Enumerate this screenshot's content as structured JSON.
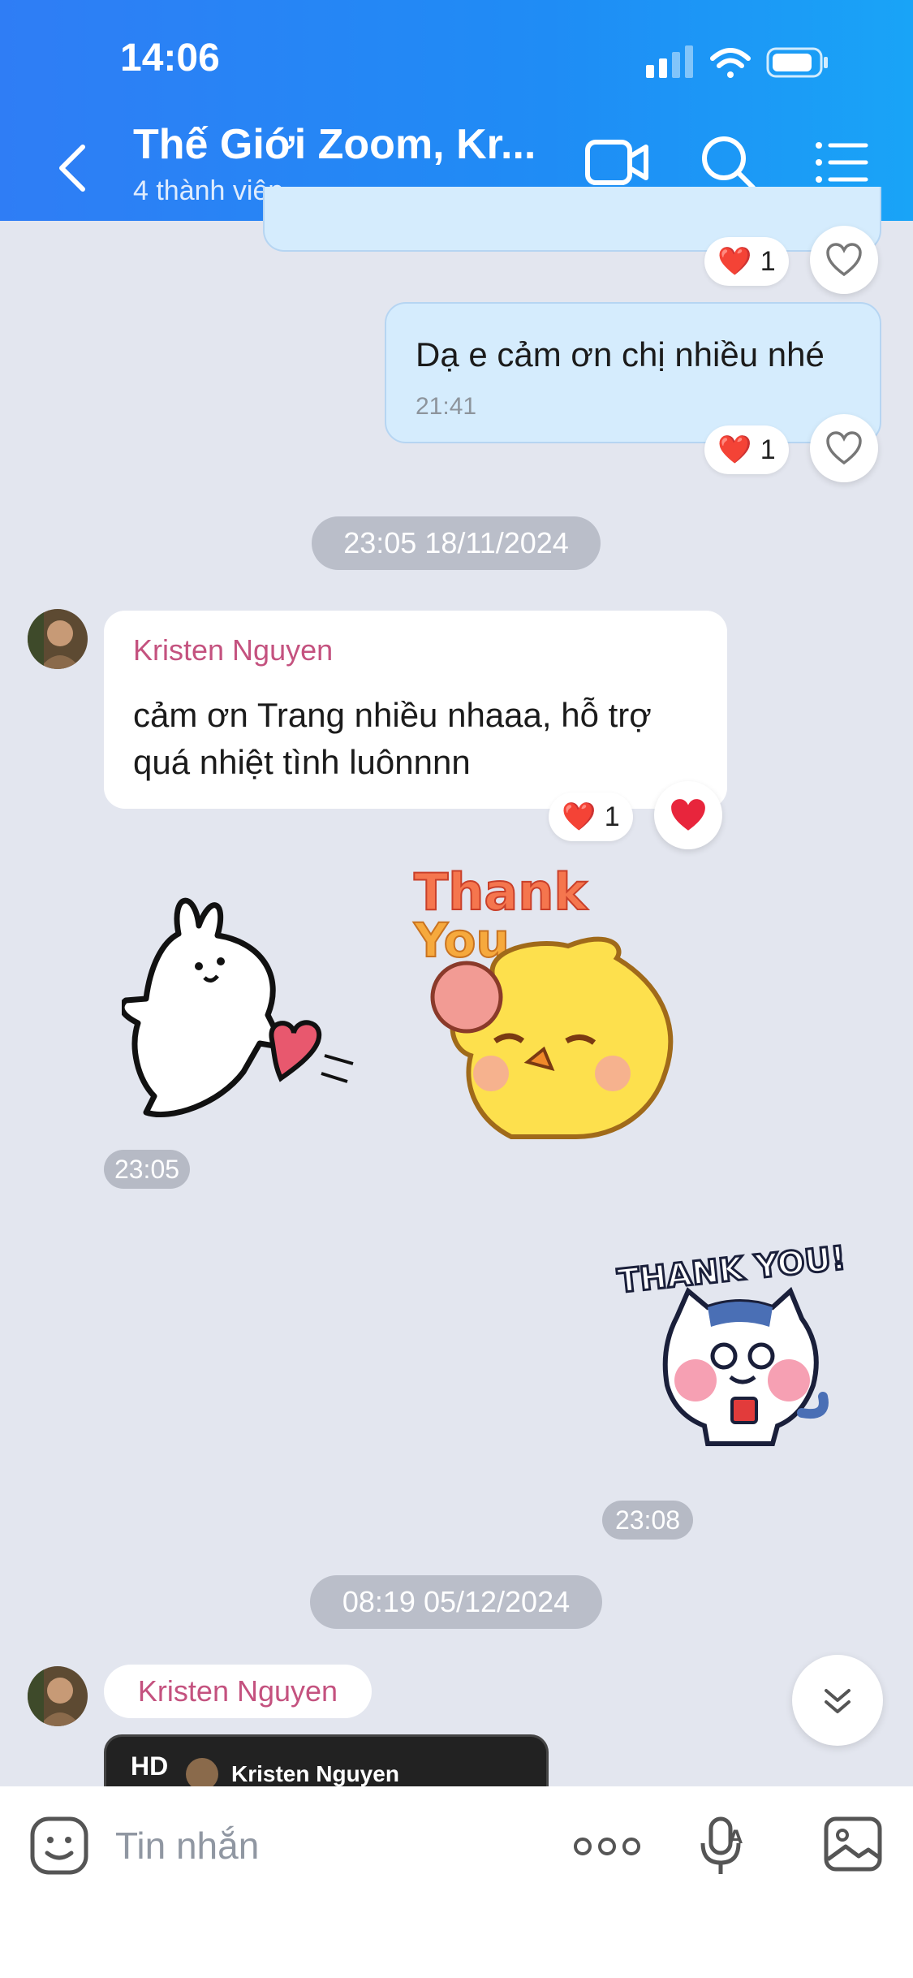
{
  "status_bar": {
    "time": "14:06"
  },
  "header": {
    "title": "Thế Giới Zoom, Kr...",
    "subtitle": "4 thành viên",
    "icons": [
      "back-icon",
      "video-call-icon",
      "search-icon",
      "menu-icon"
    ]
  },
  "messages": {
    "reaction_top": {
      "count": "1"
    },
    "mine_1": {
      "text": "Dạ e cảm ơn chị nhiều nhé",
      "time": "21:41",
      "reaction_count": "1"
    },
    "date_1": "23:05 18/11/2024",
    "kristen_1": {
      "sender": "Kristen Nguyen",
      "text": "cảm ơn Trang nhiều nhaaa, hỗ trợ quá nhiệt tình luônnnn",
      "reaction_count": "1"
    },
    "sticker_1": {
      "caption": "Thank You",
      "time": "23:05"
    },
    "sticker_2": {
      "caption": "THANK YOU!",
      "time": "23:08"
    },
    "date_2": "08:19 05/12/2024",
    "kristen_2": {
      "sender": "Kristen Nguyen",
      "video_badge": "HD",
      "video_name": "Kristen Nguyen"
    }
  },
  "composer": {
    "placeholder": "Tin nhắn",
    "icons": [
      "emoji-icon",
      "more-icon",
      "voice-to-text-icon",
      "gallery-icon"
    ]
  },
  "colors": {
    "header": "#2f7df5",
    "chat_bg": "#e3e6ef",
    "mine_bubble": "#d5ecfd",
    "sender_name": "#c4527f"
  }
}
